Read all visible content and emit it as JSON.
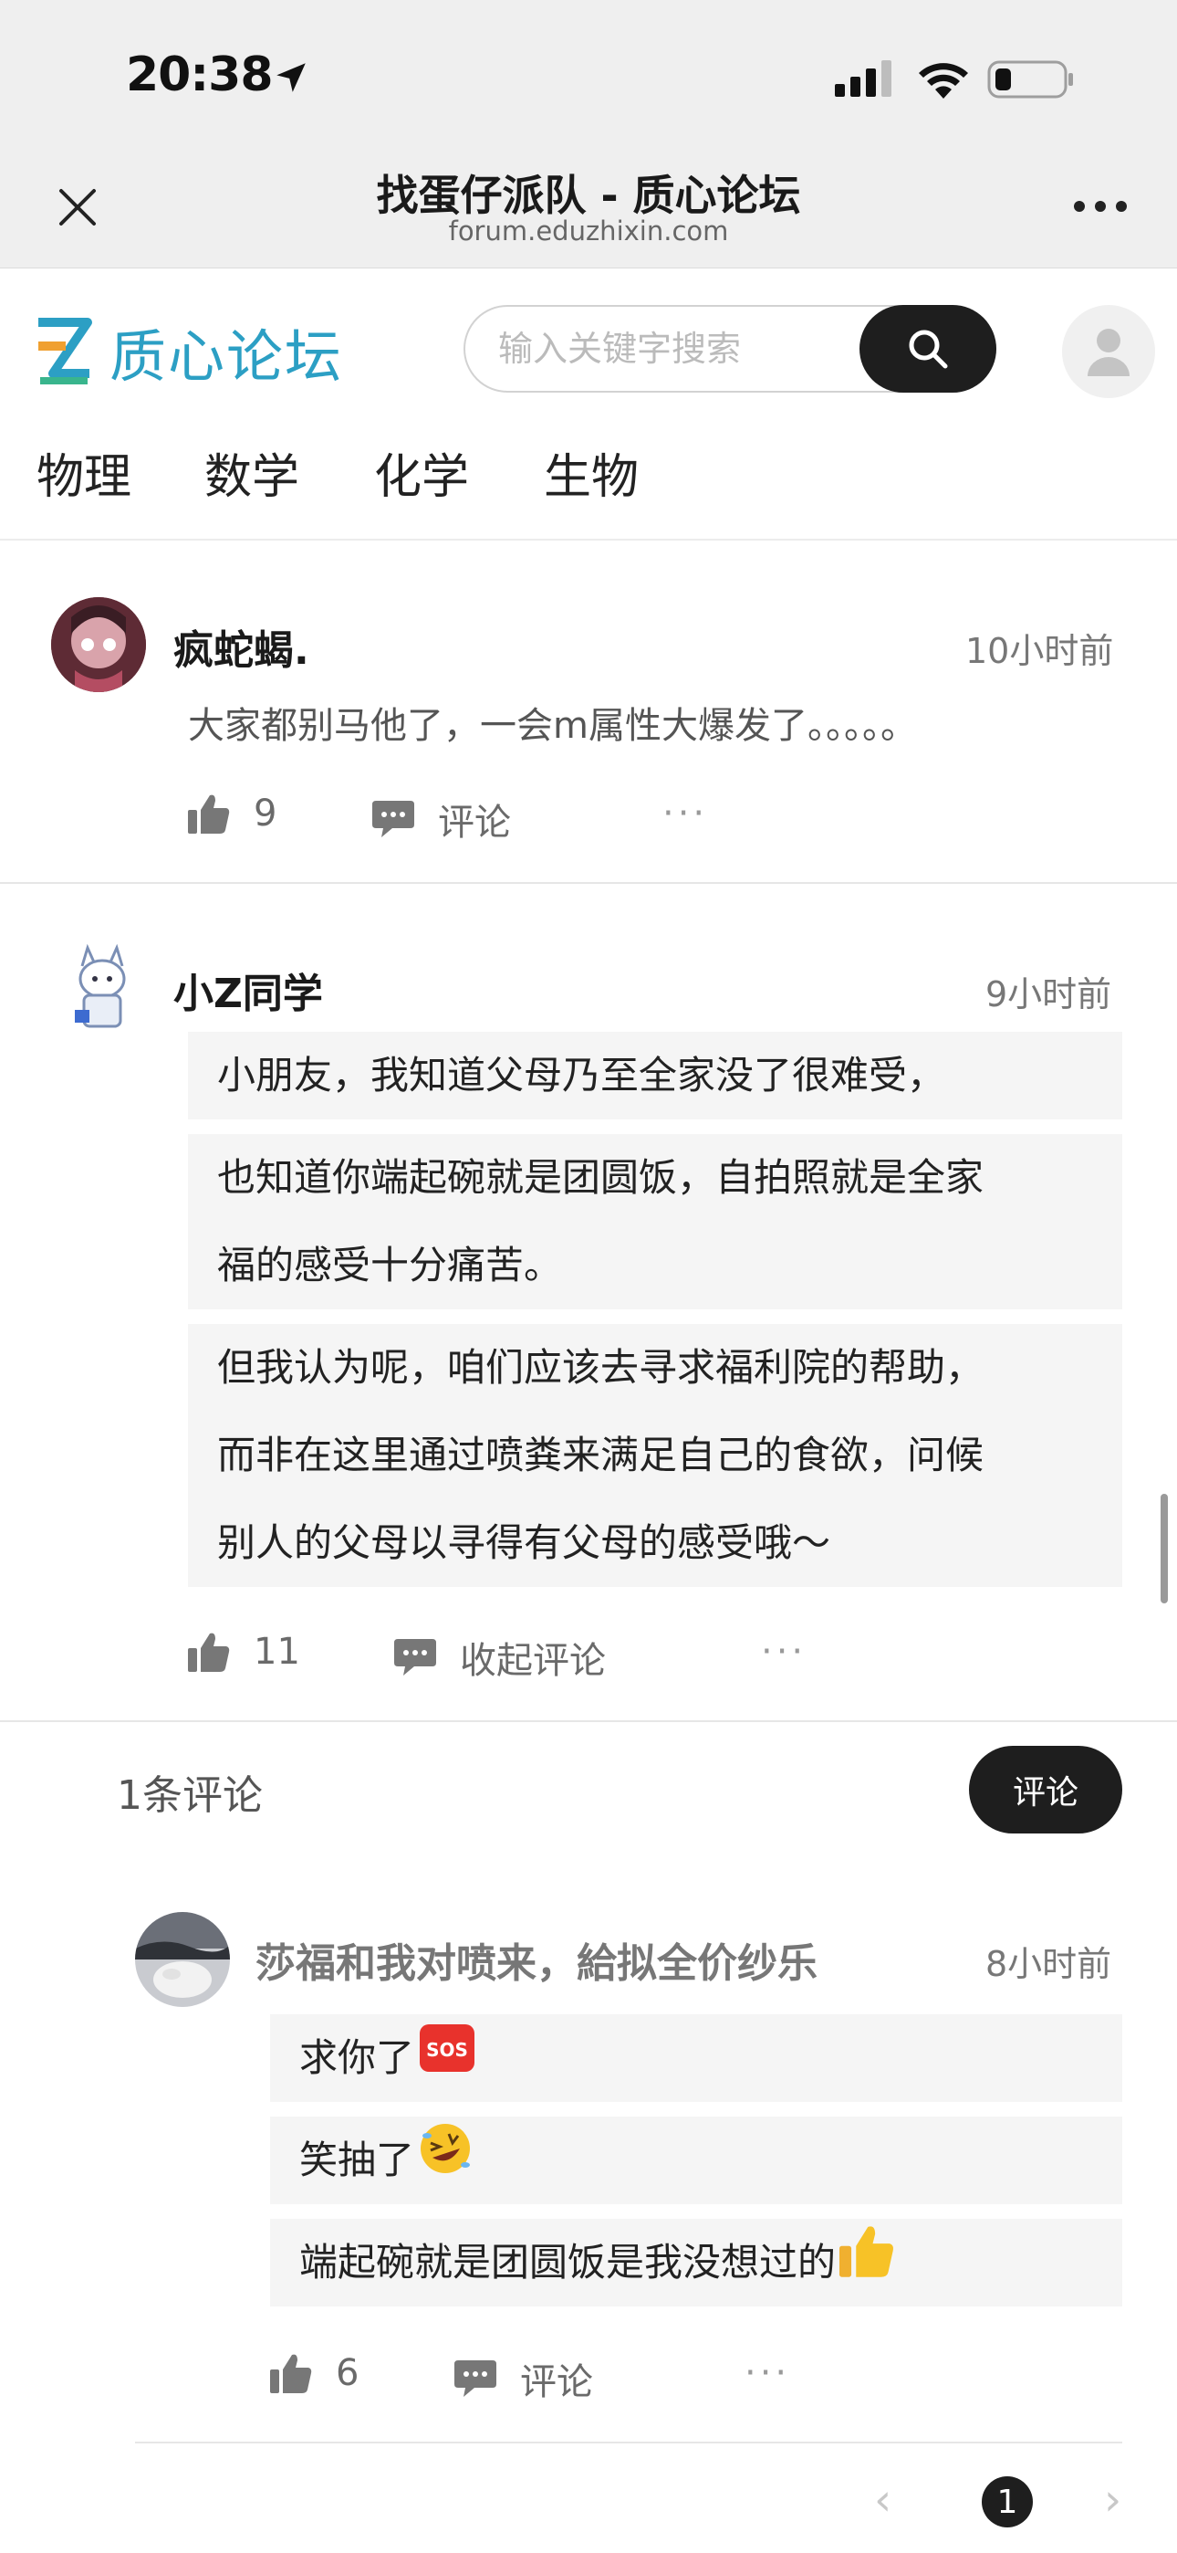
{
  "status_bar": {
    "time": "20:38"
  },
  "browser": {
    "title": "找蛋仔派队 - 质心论坛",
    "url": "forum.eduzhixin.com"
  },
  "site": {
    "logo_text": "质心论坛",
    "search_placeholder": "输入关键字搜索",
    "brand_color": "#2c9fc4"
  },
  "nav": {
    "items": [
      "物理",
      "数学",
      "化学",
      "生物"
    ]
  },
  "posts": [
    {
      "username": "疯蛇蝎.",
      "time": "10小时前",
      "text": "大家都别马他了，一会m属性大爆发了。。。。。",
      "likes": "9",
      "comment_label": "评论",
      "more": "···"
    },
    {
      "username": "小Z同学",
      "time": "9小时前",
      "paragraphs": [
        "小朋友，我知道父母乃至全家没了很难受，",
        "也知道你端起碗就是团圆饭，自拍照就是全家",
        "福的感受十分痛苦。",
        "但我认为呢，咱们应该去寻求福利院的帮助，",
        "而非在这里通过喷粪来满足自己的食欲，问候",
        "别人的父母以寻得有父母的感受哦～"
      ],
      "likes": "11",
      "comment_label": "收起评论",
      "more": "···"
    }
  ],
  "comments_section": {
    "count_label": "1条评论",
    "comment_button": "评论",
    "reply": {
      "username": "莎福和我对喷来，給拟全价纱乐",
      "time": "8小时前",
      "lines": [
        "求你了",
        "笑抽了",
        "端起碗就是团圆饭是我没想过的"
      ],
      "likes": "6",
      "comment_label": "评论",
      "more": "···"
    }
  },
  "pagination": {
    "prev": "‹",
    "current": "1",
    "next": "›"
  }
}
